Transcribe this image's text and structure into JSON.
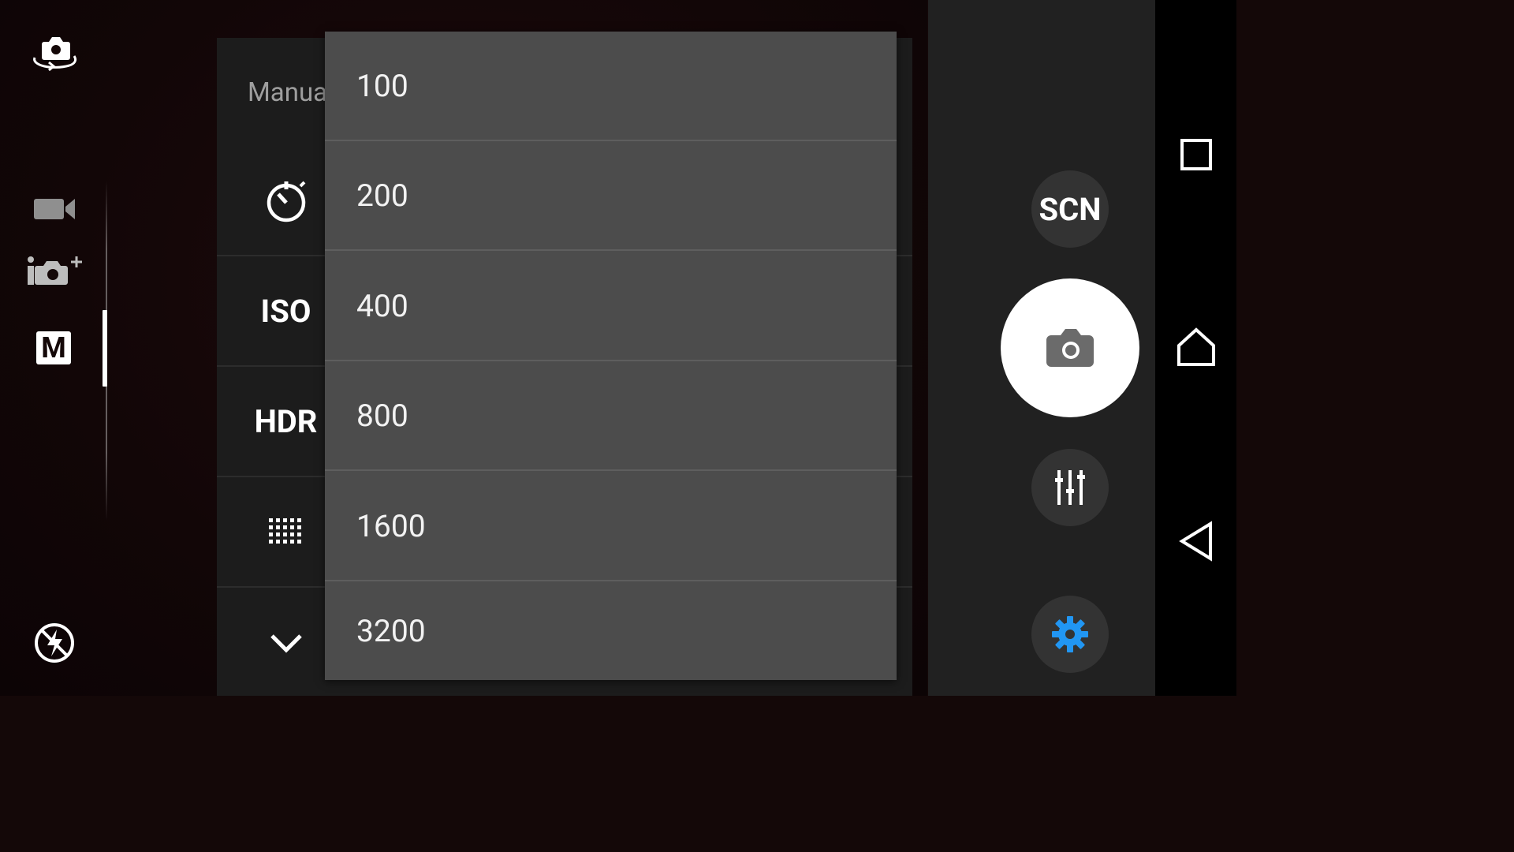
{
  "settings_panel": {
    "header_label": "Manual",
    "rows": [
      {
        "icon": "self-timer-icon",
        "label": ""
      },
      {
        "icon": "iso-icon",
        "label": "ISO"
      },
      {
        "icon": "hdr-icon",
        "label": "HDR"
      },
      {
        "icon": "grid-icon",
        "label": ""
      },
      {
        "icon": "chevron-down-icon",
        "label": ""
      }
    ]
  },
  "iso_dropdown": {
    "options": [
      "100",
      "200",
      "400",
      "800",
      "1600",
      "3200"
    ]
  },
  "left_rail": {
    "icons": [
      "switch-camera-icon",
      "video-mode-icon",
      "superior-auto-icon",
      "manual-mode-icon",
      "flash-auto-icon"
    ],
    "manual_mode_label": "M"
  },
  "controls": {
    "scene_label": "SCN",
    "shutter_icon": "camera-shutter-icon",
    "adjust_icon": "sliders-icon",
    "settings_icon": "gear-icon",
    "settings_color": "#2196F3"
  },
  "navbar": {
    "icons": [
      "recents-icon",
      "home-icon",
      "back-icon"
    ]
  }
}
